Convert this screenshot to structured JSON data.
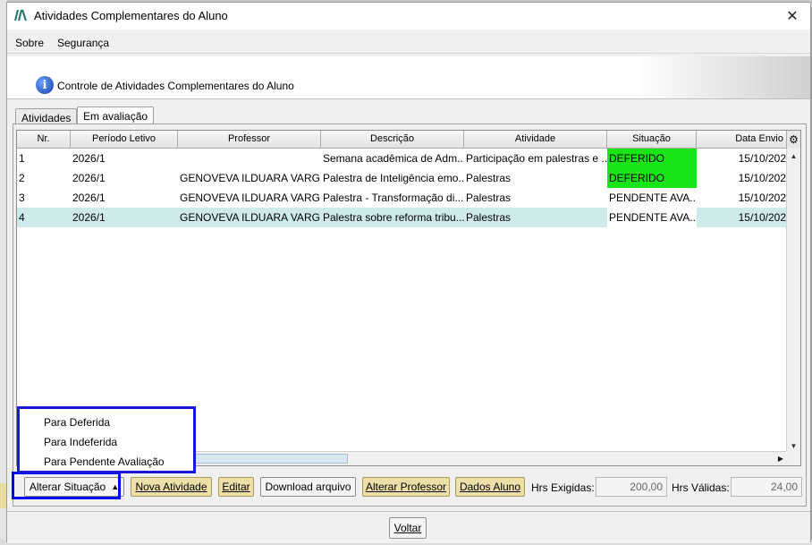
{
  "window": {
    "title": "Atividades Complementares do Aluno",
    "close_glyph": "✕"
  },
  "menu": [
    "Sobre",
    "Segurança"
  ],
  "header": {
    "title": "Controle de Atividades Complementares do Aluno",
    "icon": "info-icon"
  },
  "tabs": [
    {
      "label": "Atividades",
      "active": false
    },
    {
      "label": "Em avaliação",
      "active": true
    }
  ],
  "grid": {
    "columns": [
      "Nr.",
      "Período Letivo",
      "Professor",
      "Descrição",
      "Atividade",
      "Situação",
      "Data Envio"
    ],
    "rows": [
      [
        "1",
        "2026/1",
        "",
        "Semana acadêmica de Adm...",
        "Participação em palestras e ...",
        "DEFERIDO",
        "15/10/202"
      ],
      [
        "2",
        "2026/1",
        "GENOVEVA ILDUARA VARG...",
        "Palestra de Inteligência emo...",
        "Palestras",
        "DEFERIDO",
        "15/10/202"
      ],
      [
        "3",
        "2026/1",
        "GENOVEVA ILDUARA VARG...",
        "Palestra - Transformação di...",
        "Palestras",
        "PENDENTE AVA...",
        "15/10/202"
      ],
      [
        "4",
        "2026/1",
        "GENOVEVA ILDUARA VARG...",
        "Palestra sobre reforma tribu...",
        "Palestras",
        "PENDENTE AVA...",
        "15/10/202"
      ]
    ],
    "selected_row": 4,
    "status_colors": {
      "DEFERIDO": "#17e517"
    }
  },
  "popup_menu": [
    "Para Deferida",
    "Para Indeferida",
    "Para Pendente Avaliação"
  ],
  "toolbar": {
    "alterar_situacao": "Alterar Situação",
    "nova_atividade": "Nova Atividade",
    "editar": "Editar",
    "download": "Download arquivo",
    "alterar_professor": "Alterar Professor",
    "dados_aluno": "Dados Aluno",
    "hrs_exigidas_label": "Hrs Exigidas:",
    "hrs_exigidas_value": "200,00",
    "hrs_validas_label": "Hrs Válidas:",
    "hrs_validas_value": "24,00"
  },
  "footer": {
    "voltar": "Voltar"
  },
  "colors": {
    "highlight": "#0000ff",
    "selected_row": "#cfeaea",
    "yellow_button": "#ece0a8"
  }
}
